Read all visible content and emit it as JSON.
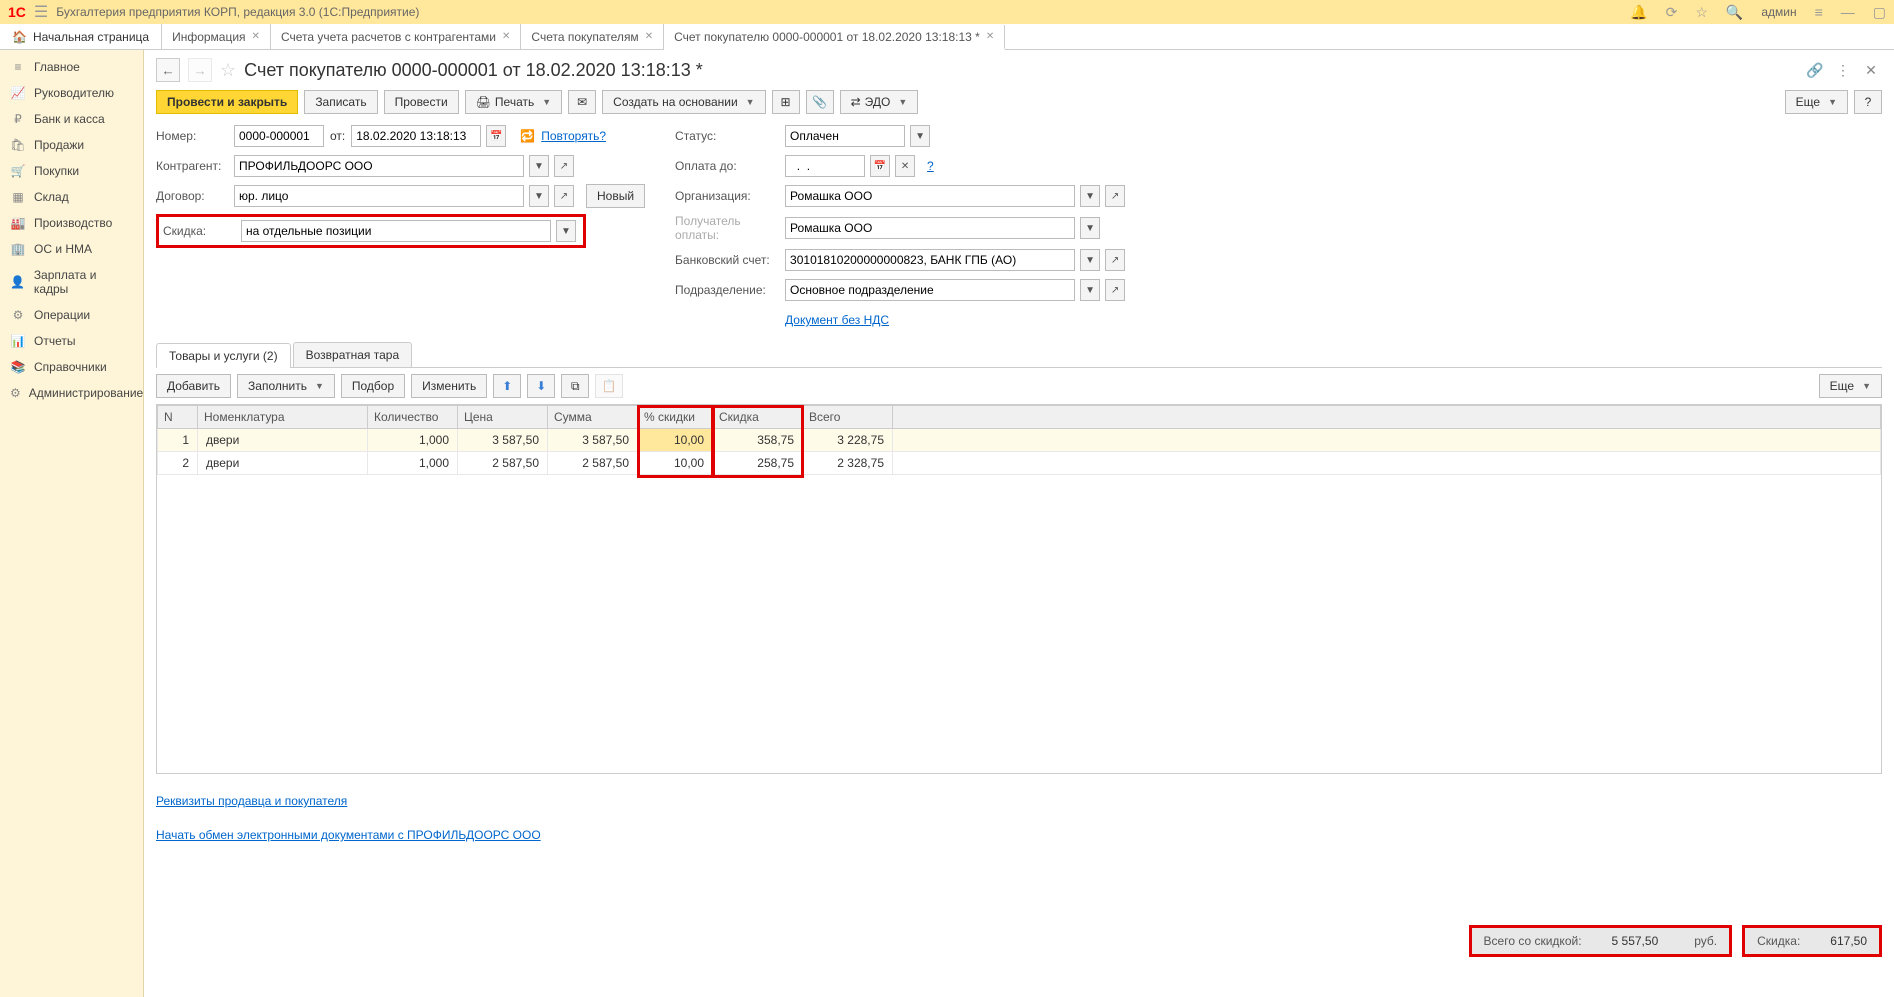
{
  "titlebar": {
    "logo": "1С",
    "title": "Бухгалтерия предприятия КОРП, редакция 3.0  (1С:Предприятие)",
    "user": "админ"
  },
  "tabs": {
    "home": "Начальная страница",
    "t1": "Информация",
    "t2": "Счета учета расчетов с контрагентами",
    "t3": "Счета покупателям",
    "t4": "Счет покупателю 0000-000001 от 18.02.2020 13:18:13 *"
  },
  "sidebar": {
    "main": "Главное",
    "manager": "Руководителю",
    "bank": "Банк и касса",
    "sales": "Продажи",
    "purchases": "Покупки",
    "warehouse": "Склад",
    "production": "Производство",
    "os": "ОС и НМА",
    "salary": "Зарплата и кадры",
    "operations": "Операции",
    "reports": "Отчеты",
    "refs": "Справочники",
    "admin": "Администрирование"
  },
  "doc": {
    "title": "Счет покупателю 0000-000001 от 18.02.2020 13:18:13 *"
  },
  "toolbar": {
    "post_close": "Провести и закрыть",
    "save": "Записать",
    "post": "Провести",
    "print": "Печать",
    "create_based": "Создать на основании",
    "edo": "ЭДО",
    "more": "Еще",
    "help": "?"
  },
  "form": {
    "number_label": "Номер:",
    "number": "0000-000001",
    "from_label": "от:",
    "date": "18.02.2020 13:18:13",
    "repeat": "Повторять?",
    "contractor_label": "Контрагент:",
    "contractor": "ПРОФИЛЬДООРС ООО",
    "contract_label": "Договор:",
    "contract": "юр. лицо",
    "new_btn": "Новый",
    "discount_label": "Скидка:",
    "discount": "на отдельные позиции",
    "status_label": "Статус:",
    "status": "Оплачен",
    "pay_until_label": "Оплата до:",
    "pay_until": "  .  .    ",
    "help_q": "?",
    "org_label": "Организация:",
    "org": "Ромашка ООО",
    "payee_label": "Получатель оплаты:",
    "payee": "Ромашка ООО",
    "bank_label": "Банковский счет:",
    "bank": "30101810200000000823, БАНК ГПБ (АО)",
    "dept_label": "Подразделение:",
    "dept": "Основное подразделение",
    "no_vat": "Документ без НДС"
  },
  "table_tabs": {
    "goods": "Товары и услуги (2)",
    "returns": "Возвратная тара"
  },
  "table_toolbar": {
    "add": "Добавить",
    "fill": "Заполнить",
    "select": "Подбор",
    "edit": "Изменить",
    "more": "Еще"
  },
  "columns": {
    "n": "N",
    "item": "Номенклатура",
    "qty": "Количество",
    "price": "Цена",
    "sum": "Сумма",
    "disc_pct": "% скидки",
    "disc": "Скидка",
    "total": "Всего"
  },
  "rows": [
    {
      "n": "1",
      "item": "двери",
      "qty": "1,000",
      "price": "3 587,50",
      "sum": "3 587,50",
      "disc_pct": "10,00",
      "disc": "358,75",
      "total": "3 228,75"
    },
    {
      "n": "2",
      "item": "двери",
      "qty": "1,000",
      "price": "2 587,50",
      "sum": "2 587,50",
      "disc_pct": "10,00",
      "disc": "258,75",
      "total": "2 328,75"
    }
  ],
  "footer": {
    "seller_link": "Реквизиты продавца и покупателя",
    "edo_link": "Начать обмен электронными документами с ПРОФИЛЬДООРС ООО",
    "total_label": "Всего со скидкой:",
    "total_value": "5 557,50",
    "currency": "руб.",
    "disc_label": "Скидка:",
    "disc_value": "617,50"
  }
}
